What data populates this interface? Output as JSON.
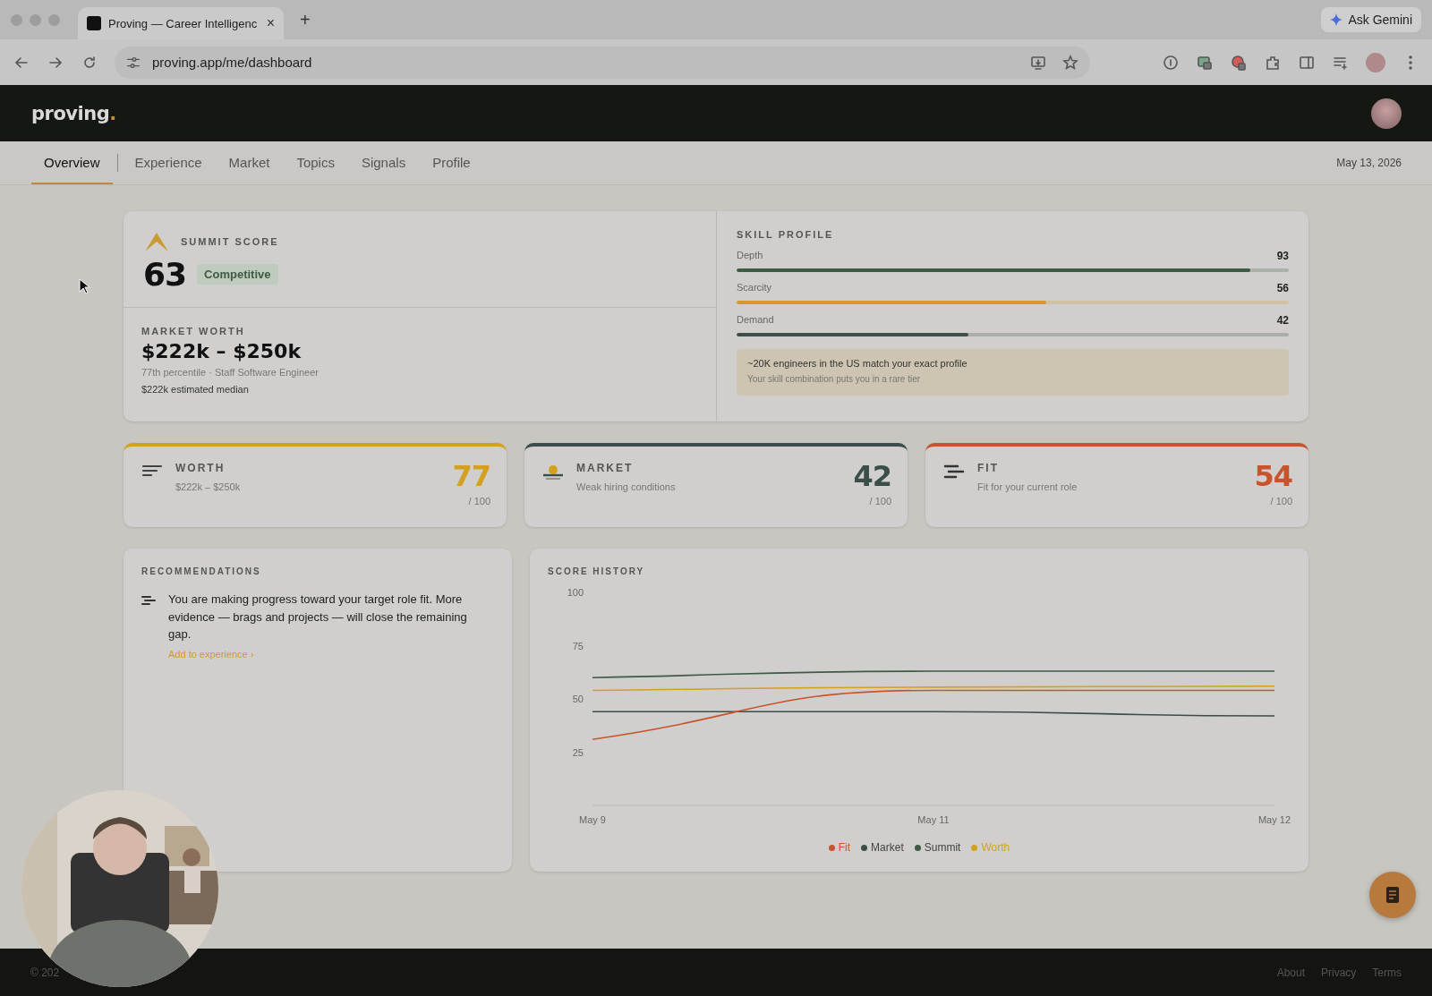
{
  "browser": {
    "tab_title": "Proving — Career Intelligenc",
    "close": "×",
    "new_tab": "+",
    "gemini": "Ask Gemini",
    "url": "proving.app/me/dashboard"
  },
  "app": {
    "logo": "proving",
    "logo_dot": "."
  },
  "nav": {
    "tabs": [
      {
        "label": "Overview",
        "selected": true
      },
      {
        "label": "Experience",
        "selected": false
      },
      {
        "label": "Market",
        "selected": false
      },
      {
        "label": "Topics",
        "selected": false
      },
      {
        "label": "Signals",
        "selected": false
      },
      {
        "label": "Profile",
        "selected": false
      }
    ],
    "date": "May 13, 2026"
  },
  "summit": {
    "label": "SUMMIT SCORE",
    "score": "63",
    "badge": "Competitive"
  },
  "worth": {
    "label": "MARKET WORTH",
    "range": "$222k – $250k",
    "detail": "77th percentile · Staff Software Engineer",
    "median": "$222k estimated median"
  },
  "skill_profile": {
    "title": "SKILL PROFILE",
    "skills": [
      {
        "name": "Depth",
        "value": "93",
        "level": 0.93,
        "color": "#3d5a45"
      },
      {
        "name": "Scarcity",
        "value": "56",
        "level": 0.56,
        "color": "#d69a2c"
      },
      {
        "name": "Demand",
        "value": "42",
        "level": 0.42,
        "color": "#3f4d4b"
      }
    ],
    "note": {
      "headline": "~20K engineers in the US match your exact profile",
      "detail": "Your skill combination puts you in a rare tier"
    }
  },
  "scores": [
    {
      "kind": "worth",
      "label": "WORTH",
      "detail": "$222k – $250k",
      "value": "77",
      "scale": "/ 100",
      "color": "#d4a020"
    },
    {
      "kind": "market",
      "label": "MARKET",
      "detail": "Weak hiring conditions",
      "value": "42",
      "scale": "/ 100",
      "color": "#3b4e4a"
    },
    {
      "kind": "fit",
      "label": "FIT",
      "detail": "Fit for your current role",
      "value": "54",
      "scale": "/ 100",
      "color": "#c9532a"
    }
  ],
  "recommendations": {
    "title": "RECOMMENDATIONS",
    "items": [
      {
        "text": "You are making progress toward your target role fit. More evidence — brags and projects — will close the remaining gap.",
        "link": "Add to experience ›"
      }
    ]
  },
  "score_history": {
    "title": "SCORE HISTORY",
    "chart_data": {
      "type": "line",
      "categories": [
        "May 9",
        "May 11",
        "May 12"
      ],
      "ylim": [
        0,
        100
      ],
      "legend": true,
      "yticks": [
        25,
        50,
        75,
        100
      ],
      "series": [
        {
          "name": "Fit",
          "color": "#c9532a",
          "values": [
            31,
            54,
            54
          ]
        },
        {
          "name": "Market",
          "color": "#3b4e4a",
          "values": [
            44,
            44,
            42
          ]
        },
        {
          "name": "Summit",
          "color": "#3d5a45",
          "values": [
            60,
            63,
            63
          ]
        },
        {
          "name": "Worth",
          "color": "#d4a020",
          "values": [
            54,
            55.5,
            56
          ]
        }
      ]
    }
  },
  "footer": {
    "copyright": "© 202",
    "links": [
      "About",
      "Privacy",
      "Terms"
    ]
  }
}
